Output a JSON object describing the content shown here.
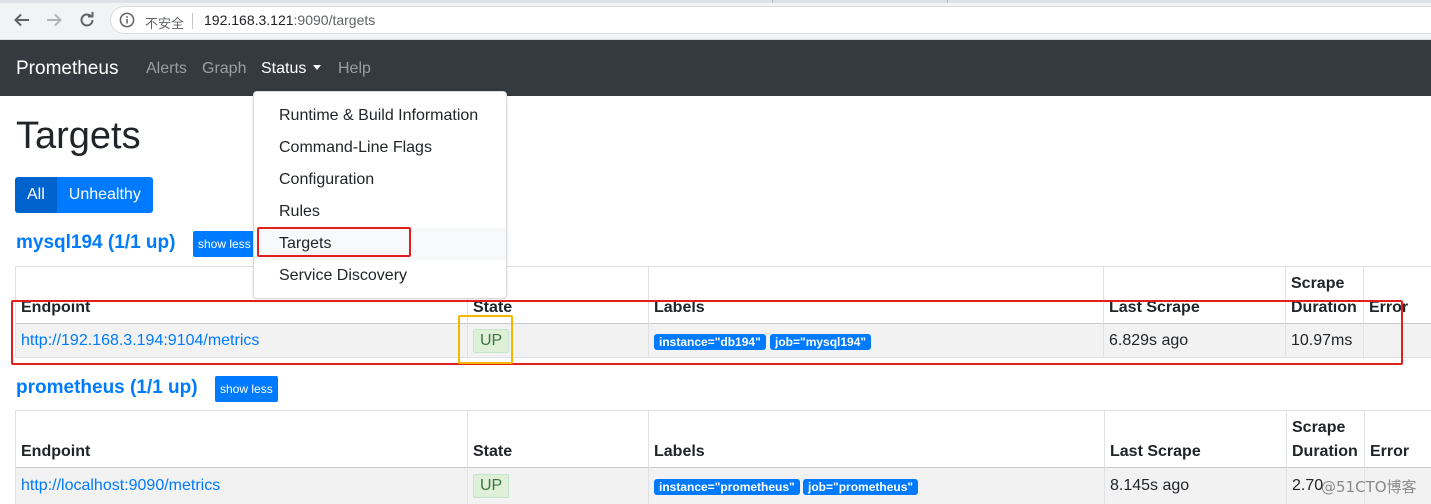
{
  "browser": {
    "insecure_label": "不安全",
    "url_host": "192.168.3.121",
    "url_rest": ":9090/targets"
  },
  "navbar": {
    "brand": "Prometheus",
    "links": {
      "alerts": "Alerts",
      "graph": "Graph",
      "status": "Status",
      "help": "Help"
    }
  },
  "status_menu": {
    "items": [
      "Runtime & Build Information",
      "Command-Line Flags",
      "Configuration",
      "Rules",
      "Targets",
      "Service Discovery"
    ]
  },
  "page": {
    "title": "Targets",
    "filters": {
      "all": "All",
      "unhealthy": "Unhealthy"
    }
  },
  "columns": {
    "endpoint": "Endpoint",
    "state": "State",
    "labels": "Labels",
    "last_scrape": "Last Scrape",
    "scrape": "Scrape",
    "duration": "Duration",
    "error": "Error"
  },
  "jobs": [
    {
      "header": "mysql194 (1/1 up)",
      "toggle": "show less",
      "row": {
        "endpoint": "http://192.168.3.194:9104/metrics",
        "state": "UP",
        "labels": [
          "instance=\"db194\"",
          "job=\"mysql194\""
        ],
        "last_scrape": "6.829s ago",
        "duration": "10.97ms",
        "error": ""
      }
    },
    {
      "header": "prometheus (1/1 up)",
      "toggle": "show less",
      "row": {
        "endpoint": "http://localhost:9090/metrics",
        "state": "UP",
        "labels": [
          "instance=\"prometheus\"",
          "job=\"prometheus\""
        ],
        "last_scrape": "8.145s ago",
        "duration": "2.70",
        "error": ""
      }
    }
  ],
  "watermark": "@51CTO博客",
  "colors": {
    "primary": "#007bff",
    "navbar": "#343a40",
    "annotation_red": "#e0201c",
    "annotation_orange": "#f5b800"
  }
}
